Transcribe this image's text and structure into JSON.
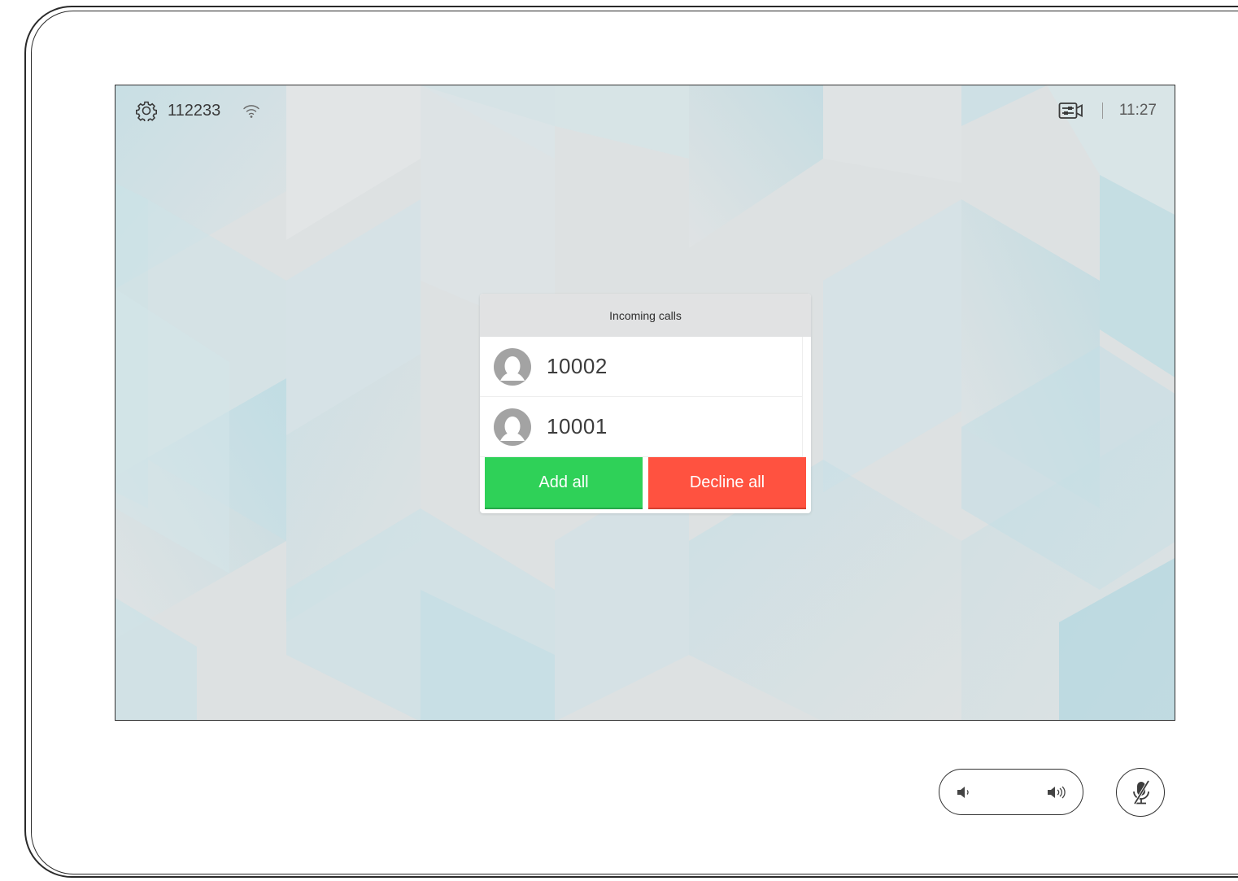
{
  "status_bar": {
    "settings_icon": "gear-icon",
    "system_number": "112233",
    "network_icon": "wifi-icon",
    "selfview_icon": "selfview-icon",
    "time": "11:27"
  },
  "incoming_dialog": {
    "title": "Incoming calls",
    "calls": [
      {
        "number": "10002",
        "icon": "avatar-icon"
      },
      {
        "number": "10001",
        "icon": "avatar-icon"
      }
    ],
    "add_all_label": "Add all",
    "decline_all_label": "Decline all"
  },
  "hardware_controls": {
    "volume_down_icon": "volume-down-icon",
    "volume_up_icon": "volume-up-icon",
    "mute_icon": "microphone-muted-icon"
  },
  "colors": {
    "add_green": "#2fd158",
    "decline_red": "#ff5240",
    "header_gray": "#e1e2e3",
    "background_tint": "#a9d6e0"
  }
}
